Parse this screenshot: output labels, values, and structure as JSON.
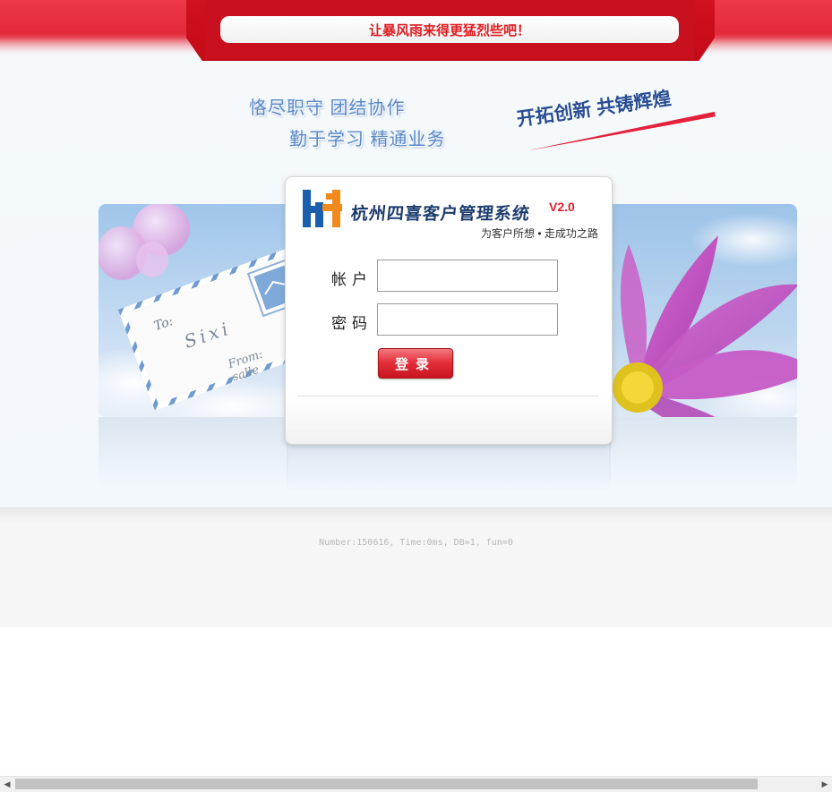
{
  "header": {
    "slogan": "让暴风雨来得更猛烈些吧！"
  },
  "mottos": {
    "line1": "恪尽职守  团结协作",
    "line2": "勤于学习  精通业务",
    "banner": "开拓创新  共铸辉煌"
  },
  "photos": {
    "envelope_to": "To:",
    "envelope_name": "Sixi",
    "envelope_from": "From: salle"
  },
  "brand": {
    "title": "杭州四喜客户管理系统",
    "version": "V2.0",
    "subtitle": "为客户所想 • 走成功之路",
    "logo_icon": "h-logo-icon",
    "logo_colors": [
      "#1a5fae",
      "#f08a1c"
    ]
  },
  "form": {
    "account_label": "帐户",
    "account_value": "",
    "password_label": "密码",
    "password_value": "",
    "login_button": "登录"
  },
  "footer": {
    "stats": "Number:150616, Time:0ms, DB=1, fun=0"
  },
  "colors": {
    "accent_red": "#e32a3a",
    "slogan_red": "#e01e23",
    "motto_blue": "#5a88c8"
  }
}
